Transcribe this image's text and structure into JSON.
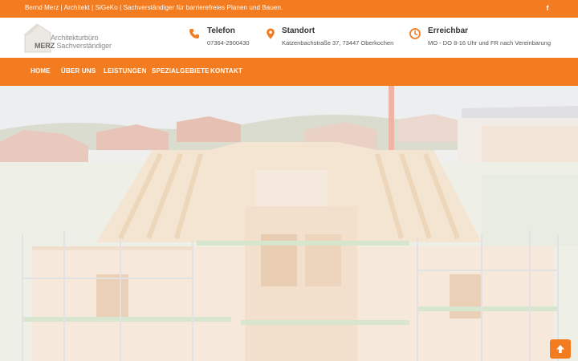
{
  "topbar": {
    "tagline": "Bernd Merz | Architekt | SiGeKo | Sachverständiger für barrierefreies Planen und Bauen.",
    "social_icon": "facebook-icon",
    "social_glyph": "f"
  },
  "logo": {
    "line1": "Architekturbüro",
    "line2_bold": "MERZ",
    "line2_rest": "Sachverständiger"
  },
  "contact": {
    "phone": {
      "title": "Telefon",
      "value": "07364-2900430",
      "icon": "phone-icon"
    },
    "location": {
      "title": "Standort",
      "value": "Katzenbachstraße 37, 73447 Oberkochen",
      "icon": "map-pin-icon"
    },
    "hours": {
      "title": "Erreichbar",
      "value": "MO - DO 8-16 Uhr und FR nach Vereinbarung",
      "icon": "clock-icon"
    }
  },
  "nav": {
    "items": [
      "HOME",
      "ÜBER UNS",
      "LEISTUNGEN",
      "SPEZIALGEBIETE",
      "KONTAKT"
    ]
  },
  "hero": {
    "image": "timber-frame-house-construction-photo"
  },
  "scroll_top": {
    "icon": "arrow-up-icon"
  },
  "colors": {
    "accent": "#f47c20",
    "header_bg": "#ffffff",
    "text_dark": "#333333",
    "text_muted": "#555555"
  }
}
